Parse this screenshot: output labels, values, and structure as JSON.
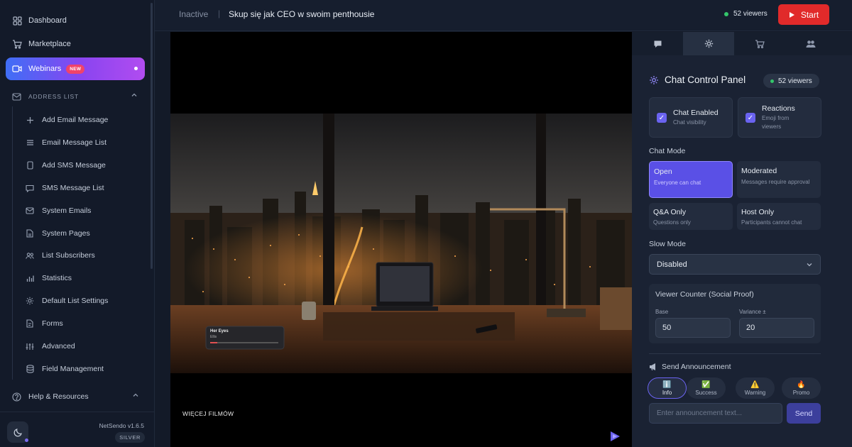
{
  "sidebar": {
    "items": [
      {
        "label": "Dashboard",
        "icon": "grid-icon"
      },
      {
        "label": "Marketplace",
        "icon": "cart-icon"
      },
      {
        "label": "Webinars",
        "icon": "video-icon",
        "badge": "NEW",
        "active": true
      }
    ],
    "section": {
      "label": "ADDRESS LIST",
      "icon": "mail-icon"
    },
    "sub_items": [
      {
        "label": "Add Email Message",
        "icon": "plus-icon"
      },
      {
        "label": "Email Message List",
        "icon": "list-icon"
      },
      {
        "label": "Add SMS Message",
        "icon": "phone-icon"
      },
      {
        "label": "SMS Message List",
        "icon": "chat-icon"
      },
      {
        "label": "System Emails",
        "icon": "mail-icon"
      },
      {
        "label": "System Pages",
        "icon": "page-icon"
      },
      {
        "label": "List Subscribers",
        "icon": "users-icon"
      },
      {
        "label": "Statistics",
        "icon": "chart-icon"
      },
      {
        "label": "Default List Settings",
        "icon": "gear-icon"
      },
      {
        "label": "Forms",
        "icon": "form-icon"
      },
      {
        "label": "Advanced",
        "icon": "sliders-icon"
      },
      {
        "label": "Field Management",
        "icon": "database-icon"
      }
    ],
    "help": {
      "label": "Help & Resources",
      "icon": "help-icon"
    },
    "version": "NetSendo v1.6.5",
    "tier": "SILVER"
  },
  "topbar": {
    "status": "Inactive",
    "separator": "|",
    "title": "Skup się jak CEO w swoim penthousie",
    "viewers": "52 viewers",
    "start_label": "Start"
  },
  "video": {
    "more_films": "WIĘCEJ FILMÓW",
    "music_card": {
      "title": "Her Eyes",
      "artist": "Ellis"
    }
  },
  "panel": {
    "tabs": [
      {
        "icon": "chat-bubble-icon"
      },
      {
        "icon": "gear-icon",
        "active": true
      },
      {
        "icon": "cart-icon"
      },
      {
        "icon": "users-icon"
      }
    ],
    "title": "Chat Control Panel",
    "viewers": "52 viewers",
    "toggles": [
      {
        "label": "Chat Enabled",
        "sub": "Chat visibility",
        "checked": true
      },
      {
        "label": "Reactions",
        "sub": "Emoji from viewers",
        "checked": true
      }
    ],
    "chat_mode_label": "Chat Mode",
    "modes": [
      {
        "title": "Open",
        "sub": "Everyone can chat",
        "active": true
      },
      {
        "title": "Moderated",
        "sub": "Messages require approval"
      },
      {
        "title": "Q&A Only",
        "sub": "Questions only"
      },
      {
        "title": "Host Only",
        "sub": "Participants cannot chat"
      }
    ],
    "slow_mode_label": "Slow Mode",
    "slow_mode_value": "Disabled",
    "viewer_counter": {
      "title": "Viewer Counter (Social Proof)",
      "base_label": "Base",
      "base_value": "50",
      "variance_label": "Variance ±",
      "variance_value": "20"
    },
    "announcement": {
      "title": "Send Announcement",
      "types": [
        {
          "label": "Info",
          "emoji": "ℹ️",
          "active": true
        },
        {
          "label": "Success",
          "emoji": "✅"
        },
        {
          "label": "Warning",
          "emoji": "⚠️"
        },
        {
          "label": "Promo",
          "emoji": "🔥"
        }
      ],
      "placeholder": "Enter announcement text...",
      "send_label": "Send"
    }
  },
  "colors": {
    "accent": "#5a50e6",
    "start": "#e12a2a",
    "live_dot": "#34c66b"
  }
}
